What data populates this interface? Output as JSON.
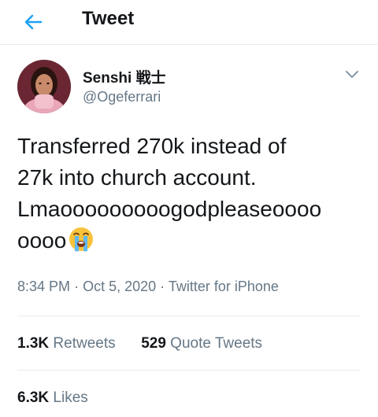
{
  "header": {
    "title": "Tweet",
    "back_icon": "back-arrow-icon"
  },
  "accent_color": "#1da1f2",
  "author": {
    "display_name": "Senshi 戦士",
    "handle": "@Ogeferrari",
    "avatar_icon": "avatar"
  },
  "tweet": {
    "line1": "Transferred 270k instead of",
    "line2": "27k into church account.",
    "line3": "Lmaooooooooogodpleaseoooo",
    "line4": "oooo",
    "emoji": "loudly-crying-face-emoji"
  },
  "meta": {
    "time": "8:34 PM",
    "date": "Oct 5, 2020",
    "source": "Twitter for iPhone"
  },
  "stats": {
    "retweets_count": "1.3K",
    "retweets_label": "Retweets",
    "quotes_count": "529",
    "quotes_label": "Quote Tweets",
    "likes_count": "6.3K",
    "likes_label": "Likes"
  }
}
